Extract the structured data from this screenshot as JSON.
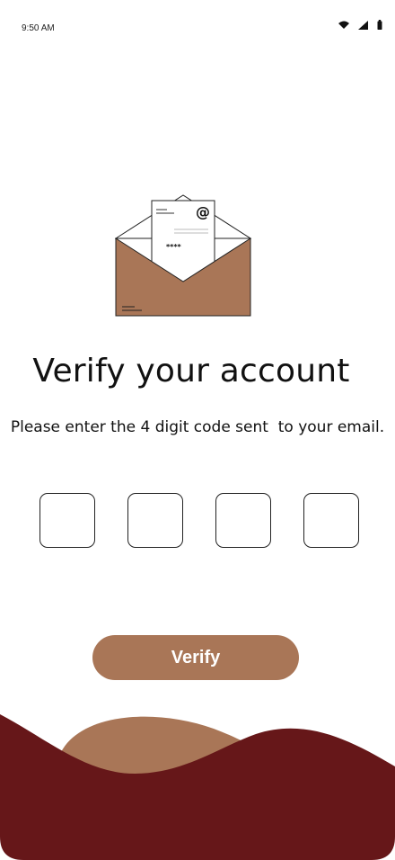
{
  "status_bar": {
    "time": "9:50 AM",
    "icons": [
      "wifi-icon",
      "cell-signal-icon",
      "battery-icon"
    ]
  },
  "illustration": {
    "name": "open-envelope-with-letter",
    "letter_symbol": "@",
    "letter_code": "****"
  },
  "verify": {
    "title": "Verify your account",
    "subtitle": "Please enter the 4 digit code sent  to your email.",
    "code_digits": [
      "",
      "",
      "",
      ""
    ],
    "button_label": "Verify"
  },
  "colors": {
    "accent": "#a97657",
    "wave_dark": "#661719",
    "wave_light": "#a97657",
    "background": "#ffffff"
  }
}
